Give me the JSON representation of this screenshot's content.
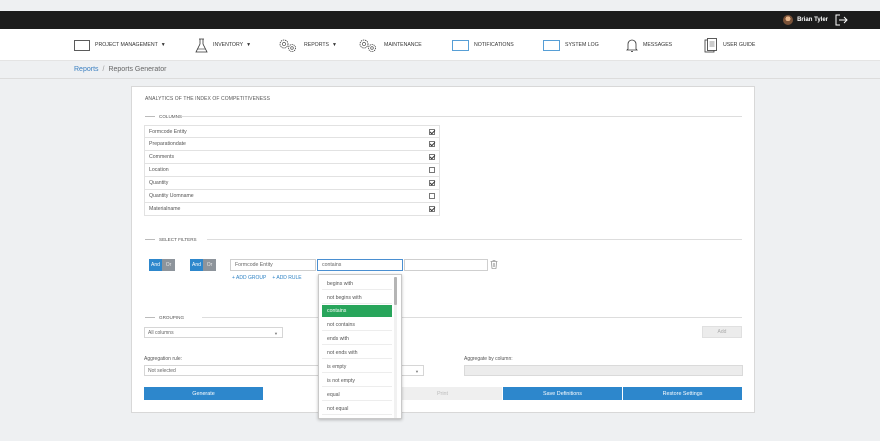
{
  "topbar": {
    "user_name": "Brian Tyler"
  },
  "nav": {
    "items": [
      {
        "label": "PROJECT MANAGEMENT",
        "has_caret": true
      },
      {
        "label": "INVENTORY",
        "has_caret": true
      },
      {
        "label": "REPORTS",
        "has_caret": true
      },
      {
        "label": "MAINTENANCE",
        "has_caret": false
      },
      {
        "label": "NOTIFICATIONS",
        "has_caret": false
      },
      {
        "label": "SYSTEM LOG",
        "has_caret": false
      },
      {
        "label": "MESSAGES",
        "has_caret": false
      },
      {
        "label": "USER GUIDE",
        "has_caret": false
      }
    ]
  },
  "breadcrumb": {
    "parent": "Reports",
    "separator": "/",
    "current": "Reports Generator"
  },
  "report": {
    "title": "ANALYTICS OF THE INDEX OF COMPETITIVENESS"
  },
  "columns": {
    "heading": "COLUMNS",
    "rows": [
      {
        "label": "Formcode Entity",
        "checked": true
      },
      {
        "label": "Preparationdate",
        "checked": true
      },
      {
        "label": "Comments",
        "checked": true
      },
      {
        "label": "Location",
        "checked": false
      },
      {
        "label": "Quantity",
        "checked": true
      },
      {
        "label": "Quantity Uomname",
        "checked": false
      },
      {
        "label": "Materialname",
        "checked": true
      }
    ]
  },
  "filters": {
    "heading": "SELECT FILTERS",
    "group1": {
      "and": "And",
      "or": "Or"
    },
    "group2": {
      "and": "And",
      "or": "Or"
    },
    "field": "Formcode Entity",
    "operator": "contains",
    "value": "",
    "add_group": "+ ADD GROUP",
    "add_rule": "+ ADD RULE",
    "operator_options": [
      "begins with",
      "not begins with",
      "contains",
      "not contains",
      "ends with",
      "not ends with",
      "is empty",
      "is not empty",
      "equal",
      "not equal"
    ],
    "selected_option": "contains"
  },
  "grouping": {
    "heading": "GROUPING",
    "columns_select": "All columns",
    "add_label": "Add",
    "aggregation_rule_label": "Aggregation rule:",
    "aggregation_rule_value": "Not selected",
    "aggregate_by_label": "Aggregate by column:"
  },
  "actions": {
    "generate": "Generate",
    "print": "Print",
    "save": "Save Definitions",
    "restore": "Restore Settings"
  },
  "colors": {
    "primary": "#2d87cc",
    "selected": "#28a55b",
    "topbar": "#1c1c1c"
  }
}
